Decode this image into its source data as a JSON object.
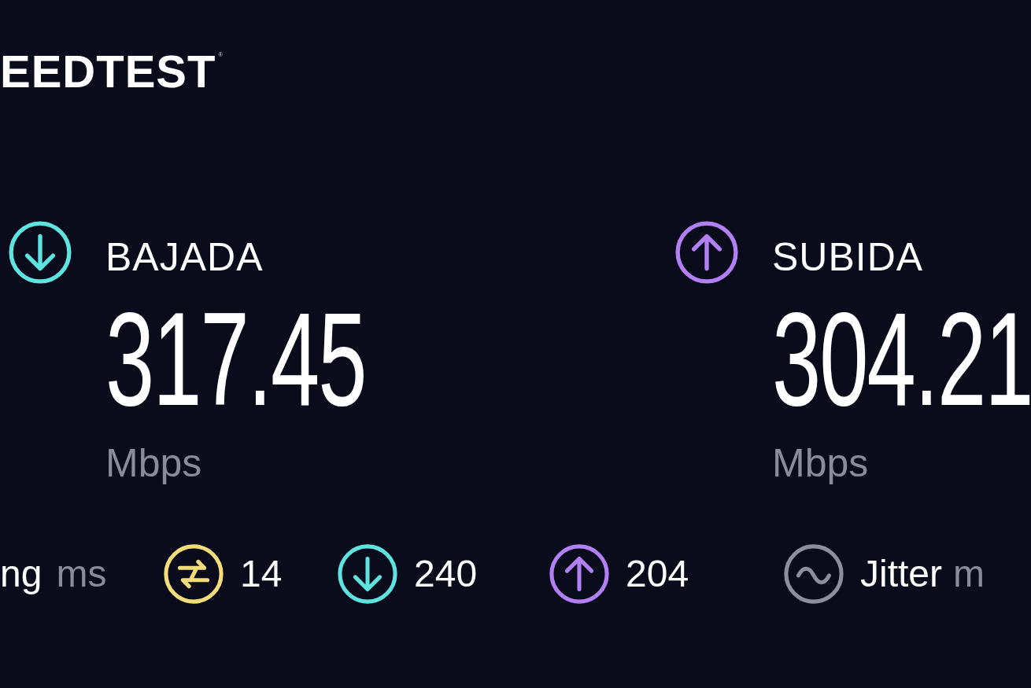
{
  "brand": {
    "text": "EEDTEST",
    "mark": "®"
  },
  "results": [
    {
      "kind": "download",
      "label": "BAJADA",
      "value": "317.45",
      "unit": "Mbps",
      "color": "#5fe3e0"
    },
    {
      "kind": "upload",
      "label": "SUBIDA",
      "value": "304.21",
      "unit": "Mbps",
      "color": "#b27ff5"
    }
  ],
  "ping": {
    "label": "ng",
    "unit": "ms",
    "items": [
      {
        "kind": "idle",
        "value": "14",
        "color": "#f2dd7a"
      },
      {
        "kind": "download",
        "value": "240",
        "color": "#5fe3e0"
      },
      {
        "kind": "upload",
        "value": "204",
        "color": "#b27ff5"
      }
    ]
  },
  "jitter": {
    "kind": "wave",
    "label": "Jitter",
    "unit": "m",
    "color": "#8d8f9c"
  }
}
